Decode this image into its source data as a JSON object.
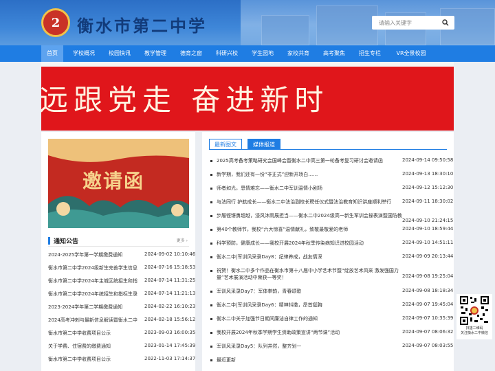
{
  "header": {
    "logo_text": "2",
    "school_name": "衡水市第二中学",
    "search_placeholder": "请输入关键字"
  },
  "nav": [
    {
      "label": "首页",
      "active": true
    },
    {
      "label": "学校概况"
    },
    {
      "label": "校园快讯"
    },
    {
      "label": "教学管理"
    },
    {
      "label": "德育之窗"
    },
    {
      "label": "科研兴校"
    },
    {
      "label": "学生园地"
    },
    {
      "label": "家校共育"
    },
    {
      "label": "高考聚焦"
    },
    {
      "label": "招生专栏"
    },
    {
      "label": "VR全景校园"
    }
  ],
  "banner": {
    "text": "远跟党走  奋进新时"
  },
  "invite": {
    "title": "邀请函"
  },
  "notice": {
    "title": "通知公告",
    "more": "更多 ›",
    "items": [
      {
        "title": "2024-2025学年第一学期缴费通知",
        "date": "2024-09-02 10:10:46"
      },
      {
        "title": "衡水市第二中学2024级新生完善学生信息",
        "date": "2024-07-16 15:18:53"
      },
      {
        "title": "衡水市第二中学2024年主城区统招生和指",
        "date": "2024-07-14 11:31:25"
      },
      {
        "title": "衡水市第二中学2024年统招生和指标生录",
        "date": "2024-07-14 11:21:13"
      },
      {
        "title": "2023-2024学年第二学期缴费通知",
        "date": "2024-02-22 16:10:23"
      },
      {
        "title": "2024高考冲刺与最新信息解读暨衡水二中",
        "date": "2024-02-18 15:56:12"
      },
      {
        "title": "衡水市第二中学收费项目公示",
        "date": "2023-09-03 16:00:35"
      },
      {
        "title": "关于学费、住宿费的缴费通知",
        "date": "2023-01-14 17:45:39"
      },
      {
        "title": "衡水市第二中学收费项目公示",
        "date": "2022-11-03 17:14:37"
      }
    ]
  },
  "news": {
    "tabs": [
      "最新图文",
      "媒体报道"
    ],
    "items": [
      {
        "title": "2025高考备考策略研究会国峰会暨衡水二中高三第一轮备考复习研讨会邀请函",
        "date": "2024-09-14 09:50:58"
      },
      {
        "title": "新学期，我们还有一份“非正式”迎新开场白……",
        "date": "2024-09-13 18:30:10"
      },
      {
        "title": "师者如光，恩情难忘——衡水二中军训温情小剧场",
        "date": "2024-09-12 15:12:30"
      },
      {
        "title": "与法同行 护航成长——衡水二中法治副校长聘任仪式暨法治教育知识讲座顺利举行",
        "date": "2024-09-11 18:30:02"
      },
      {
        "title": "步履铿锵勇超越，浸风沐雨展担当——衡水二中2024级高一新生军训会操表演暨国防教育闭营仪式成功举行",
        "date": "2024-09-10 21:24:15"
      },
      {
        "title": "第40个教师节，我校“六大惊喜”温情献礼，致敬最敬爱的老师",
        "date": "2024-09-10 18:59:44"
      },
      {
        "title": "科学预防，健康成长——我校开展2024年秋季传染病知识进校园活动",
        "date": "2024-09-10 14:51:11"
      },
      {
        "title": "衡水二中|军训风采录Day8：纪律养成，战友情深",
        "date": "2024-09-09 20:13:44"
      },
      {
        "title": "祝贺！衡水二中多个作品在衡水市第十八届中小学艺术节暨“绽放艺术风采 激发强国力量”艺术展演活动中荣获一等奖！",
        "date": "2024-09-08 19:25:04"
      },
      {
        "title": "军训风采录Day7：军体拳韵，青春颂歌",
        "date": "2024-09-08 18:18:34"
      },
      {
        "title": "衡水二中|军训风采录Day6：精神抖擞，昂首挺胸",
        "date": "2024-09-07 19:45:04"
      },
      {
        "title": "衡水二中关于加强节日期间廉洁自律工作的通知",
        "date": "2024-09-07 10:35:39"
      },
      {
        "title": "我校开展2024年秋季学期学生资助政策宣讲“两节课”活动",
        "date": "2024-09-07 08:06:32"
      },
      {
        "title": "军训风采录Day5：队列井然，整齐划一",
        "date": "2024-09-07 08:03:55"
      },
      {
        "title": "最近更新",
        "date": ""
      }
    ]
  },
  "qr": {
    "caption_1": "扫描二维码",
    "caption_2": "关注衡水二中微信"
  }
}
